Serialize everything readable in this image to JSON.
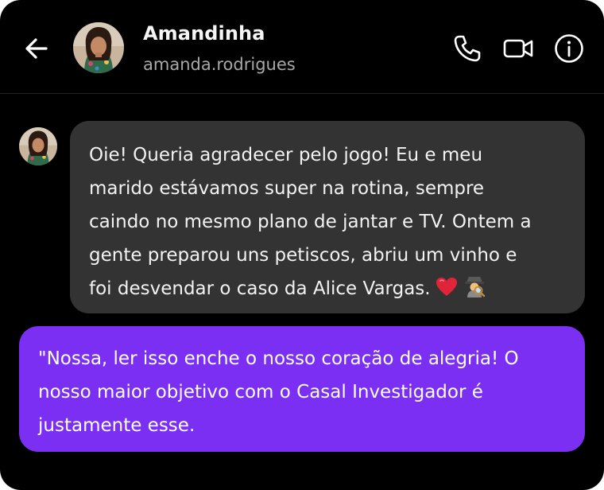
{
  "header": {
    "contact_name": "Amandinha",
    "contact_handle": "amanda.rodrigues",
    "icons": [
      "back-arrow-icon",
      "phone-icon",
      "video-camera-icon",
      "info-icon"
    ]
  },
  "messages": [
    {
      "direction": "incoming",
      "text": "Oie! Queria agradecer pelo jogo! Eu e meu\nmarido estávamos super na rotina, sempre\ncaindo no mesmo plano de jantar e TV. Ontem a\ngente preparou uns petiscos, abriu um vinho e\nfoi desvendar o caso da Alice Vargas.",
      "emojis": [
        "heart-emoji",
        "detective-emoji"
      ]
    },
    {
      "direction": "outgoing",
      "text": "\"Nossa, ler isso enche o nosso coração de alegria! O\nnosso maior objetivo com o Casal Investigador é\njustamente esse."
    }
  ],
  "colors": {
    "background": "#000000",
    "incoming_bubble": "#333334",
    "outgoing_bubble": "#7b2ff2",
    "name_text": "#f5f5f5",
    "handle_text": "#a8a8a8"
  }
}
